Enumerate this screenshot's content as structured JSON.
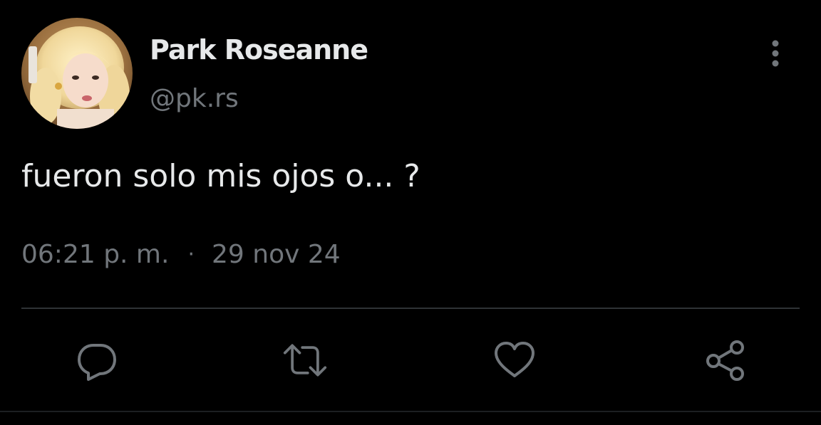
{
  "tweet": {
    "author": {
      "display_name": "Park Roseanne",
      "handle": "@pk.rs",
      "avatar_icon": "profile-photo"
    },
    "text": "fueron solo mis ojos o... ?",
    "time": "06:21 p. m.",
    "separator": "·",
    "date": "29 nov 24",
    "menu_icon": "more-vertical-icon",
    "actions": [
      {
        "name": "reply",
        "icon": "comment-icon"
      },
      {
        "name": "retweet",
        "icon": "retweet-icon"
      },
      {
        "name": "like",
        "icon": "heart-icon"
      },
      {
        "name": "share",
        "icon": "share-icon"
      }
    ]
  },
  "colors": {
    "background": "#000000",
    "primary_text": "#e7e9ea",
    "secondary_text": "#71767b",
    "divider": "#2f3336"
  }
}
